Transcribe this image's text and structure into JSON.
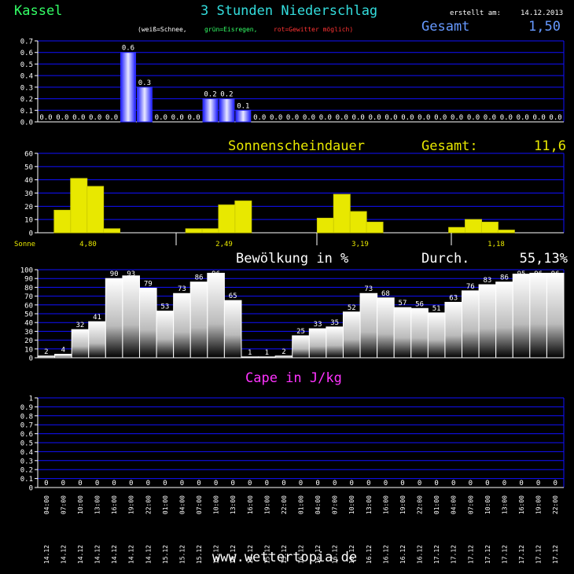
{
  "header": {
    "location": "Kassel",
    "title": "3 Stunden Niederschlag",
    "created_label": "erstellt am:",
    "created_date": "14.12.2013",
    "legend_white": "(weiß=Schnee,",
    "legend_green": "grün=Eisregen,",
    "legend_red": "rot=Gewitter möglich)",
    "total_label": "Gesamt",
    "total_value": "1,50"
  },
  "colors": {
    "background": "#000000",
    "grid": "#1010ff",
    "precip_bar": "#2a2aff",
    "sun_bar": "#e8e800",
    "cloud_bar": "#ffffff",
    "location": "#33ff66",
    "title": "#33dddd",
    "total": "#6699ff",
    "cape_title": "#ff33ff",
    "footer": "#ffffff"
  },
  "footer": {
    "site": "www.wettertopia.de"
  },
  "chart_data": [
    {
      "id": "precip",
      "type": "bar",
      "ylim": [
        0,
        0.7
      ],
      "yticks": [
        "0.0",
        "0.1",
        "0.2",
        "0.3",
        "0.4",
        "0.5",
        "0.6",
        "0.7"
      ],
      "values": [
        0,
        0,
        0,
        0,
        0,
        0.6,
        0.3,
        0,
        0,
        0,
        0.2,
        0.2,
        0.1,
        0,
        0,
        0,
        0,
        0,
        0,
        0,
        0,
        0,
        0,
        0,
        0,
        0,
        0,
        0,
        0,
        0,
        0,
        0
      ],
      "labels": [
        "0.0",
        "0.0",
        "0.0",
        "0.0",
        "0.0",
        "0.6",
        "0.3",
        "0.0",
        "0.0",
        "0.0",
        "0.2",
        "0.2",
        "0.1",
        "0.0",
        "0.0",
        "0.0",
        "0.0",
        "0.0",
        "0.0",
        "0.0",
        "0.0",
        "0.0",
        "0.0",
        "0.0",
        "0.0",
        "0.0",
        "0.0",
        "0.0",
        "0.0",
        "0.0",
        "0.0",
        "0.0"
      ]
    },
    {
      "id": "sun",
      "type": "bar",
      "title": "Sonnenscheindauer",
      "total_label": "Gesamt:",
      "total_value": "11,6",
      "row_label": "Sonne",
      "day_totals": [
        "4,80",
        "2,49",
        "3,19",
        "1,18"
      ],
      "ylim": [
        0,
        60
      ],
      "yticks": [
        "0",
        "10",
        "20",
        "30",
        "40",
        "50",
        "60"
      ],
      "values": [
        0,
        17,
        41,
        35,
        3,
        0,
        0,
        0,
        0,
        3,
        3,
        21,
        24,
        0,
        0,
        0,
        0,
        11,
        29,
        16,
        8,
        0,
        0,
        0,
        0,
        4,
        10,
        8,
        2,
        0,
        0,
        0
      ]
    },
    {
      "id": "cloud",
      "type": "bar",
      "title": "Bewölkung in %",
      "total_label": "Durch.",
      "total_value": "55,13%",
      "ylim": [
        0,
        100
      ],
      "yticks": [
        "0",
        "10",
        "20",
        "30",
        "40",
        "50",
        "60",
        "70",
        "80",
        "90",
        "100"
      ],
      "values": [
        2,
        4,
        32,
        41,
        90,
        93,
        79,
        53,
        73,
        86,
        96,
        65,
        1,
        1,
        2,
        25,
        33,
        35,
        52,
        73,
        68,
        57,
        56,
        51,
        63,
        76,
        83,
        86,
        95,
        96,
        96
      ]
    },
    {
      "id": "cape",
      "type": "bar",
      "title": "Cape in J/kg",
      "ylim": [
        0,
        1
      ],
      "yticks": [
        "0",
        "0.1",
        "0.2",
        "0.3",
        "0.4",
        "0.5",
        "0.6",
        "0.7",
        "0.8",
        "0.9",
        "1"
      ],
      "values": [
        0,
        0,
        0,
        0,
        0,
        0,
        0,
        0,
        0,
        0,
        0,
        0,
        0,
        0,
        0,
        0,
        0,
        0,
        0,
        0,
        0,
        0,
        0,
        0,
        0,
        0,
        0,
        0,
        0,
        0,
        0
      ],
      "labels": [
        "0",
        "0",
        "0",
        "0",
        "0",
        "0",
        "0",
        "0",
        "0",
        "0",
        "0",
        "0",
        "0",
        "0",
        "0",
        "0",
        "0",
        "0",
        "0",
        "0",
        "0",
        "0",
        "0",
        "0",
        "0",
        "0",
        "0",
        "0",
        "0",
        "0",
        "0"
      ]
    }
  ],
  "x_axis": {
    "times": [
      "04:00",
      "07:00",
      "10:00",
      "13:00",
      "16:00",
      "19:00",
      "22:00",
      "01:00",
      "04:00",
      "07:00",
      "10:00",
      "13:00",
      "16:00",
      "19:00",
      "22:00",
      "01:00",
      "04:00",
      "07:00",
      "10:00",
      "13:00",
      "16:00",
      "19:00",
      "22:00",
      "01:00",
      "04:00",
      "07:00",
      "10:00",
      "13:00",
      "16:00",
      "19:00",
      "22:00"
    ],
    "dates": [
      "14.12",
      "14.12",
      "14.12",
      "14.12",
      "14.12",
      "14.12",
      "14.12",
      "15.12",
      "15.12",
      "15.12",
      "15.12",
      "15.12",
      "15.12",
      "15.12",
      "15.12",
      "16.12",
      "16.12",
      "16.12",
      "16.12",
      "16.12",
      "16.12",
      "16.12",
      "16.12",
      "17.12",
      "17.12",
      "17.12",
      "17.12",
      "17.12",
      "17.12",
      "17.12",
      "17.12"
    ]
  }
}
